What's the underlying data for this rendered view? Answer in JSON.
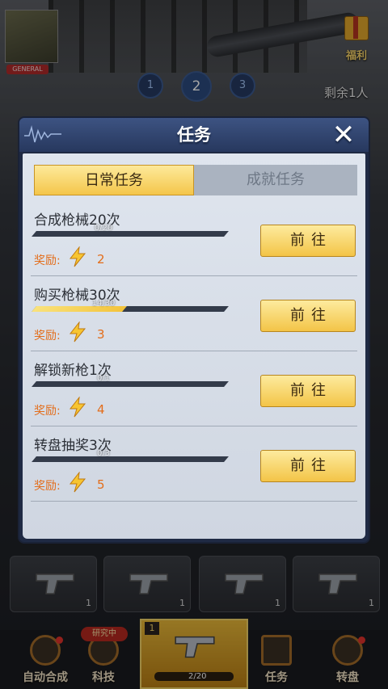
{
  "background": {
    "avatar_tag": "GENERAL",
    "gift_label": "福利",
    "waves": [
      "1",
      "2",
      "3"
    ],
    "remaining": "剩余1人",
    "slot_levels": [
      "1",
      "1",
      "1",
      "1"
    ],
    "nav": {
      "badge": "研究中",
      "items": [
        {
          "label": "自动合成",
          "icon": "auto-merge-icon"
        },
        {
          "label": "科技",
          "icon": "atom-icon"
        },
        {
          "label": "任务",
          "icon": "task-icon"
        },
        {
          "label": "转盘",
          "icon": "wheel-icon"
        }
      ],
      "center_level": "1",
      "center_count": "2/20"
    }
  },
  "panel": {
    "title": "任务",
    "close_icon": "close-icon",
    "tabs": [
      {
        "label": "日常任务",
        "active": true
      },
      {
        "label": "成就任务",
        "active": false
      }
    ],
    "reward_label": "奖励:",
    "tasks": [
      {
        "name": "合成枪械20次",
        "progress": "0/20",
        "fraction": 0.0,
        "reward": "2",
        "button": "前往"
      },
      {
        "name": "购买枪械30次",
        "progress": "14/30",
        "fraction": 0.47,
        "reward": "3",
        "button": "前往"
      },
      {
        "name": "解锁新枪1次",
        "progress": "0/1",
        "fraction": 0.0,
        "reward": "4",
        "button": "前往"
      },
      {
        "name": "转盘抽奖3次",
        "progress": "0/3",
        "fraction": 0.0,
        "reward": "5",
        "button": "前往"
      }
    ]
  },
  "colors": {
    "accent_gold": "#f3c447",
    "reward_orange": "#e36d1a",
    "header_blue": "#3d5382"
  }
}
